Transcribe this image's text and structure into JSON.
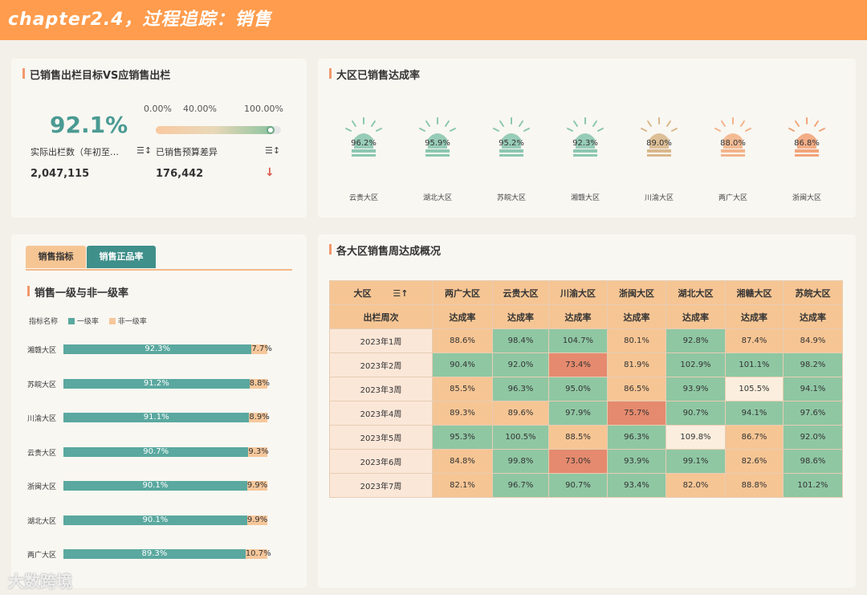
{
  "header": {
    "title": "chapter2.4，过程追踪：销售"
  },
  "kpi_panel": {
    "title": "已销售出栏目标VS应销售出栏",
    "rate": "92.1%",
    "rate_label": "实际出栏数（年初至…",
    "rate_value": "2,047,115",
    "slider_ticks": [
      "0.00%",
      "40.00%",
      "100.00%"
    ],
    "slider_level": 0.92,
    "diff_label": "已销售预算差异",
    "diff_value": "176,442",
    "sort_glyph": "☰↕",
    "down_arrow": "↓",
    "colors": {
      "rate": "#4a9a92",
      "arrow": "#d9574a"
    }
  },
  "alarm_panel": {
    "title": "大区已销售达成率",
    "regions": [
      {
        "name": "云贵大区",
        "pct": "96.2%",
        "color": "#8cc7b0"
      },
      {
        "name": "湖北大区",
        "pct": "95.9%",
        "color": "#8cc7b0"
      },
      {
        "name": "苏皖大区",
        "pct": "95.2%",
        "color": "#8cc7b0"
      },
      {
        "name": "湘赣大区",
        "pct": "92.3%",
        "color": "#8cc7b0"
      },
      {
        "name": "川渝大区",
        "pct": "89.0%",
        "color": "#d9b88c"
      },
      {
        "name": "两广大区",
        "pct": "88.0%",
        "color": "#f2b48a"
      },
      {
        "name": "浙闽大区",
        "pct": "86.8%",
        "color": "#f2a47a"
      }
    ]
  },
  "bar_panel": {
    "tabs": [
      "销售指标",
      "销售正品率"
    ],
    "active_tab": 1,
    "title": "销售一级与非一级率",
    "legend_title": "指标名称",
    "legend": [
      {
        "name": "一级率",
        "color": "#5aa89f"
      },
      {
        "name": "非一级率",
        "color": "#f6c79b"
      }
    ],
    "rows": [
      {
        "region": "湘赣大区",
        "first": "92.3%",
        "other": "7.7%",
        "first_val": 92.3
      },
      {
        "region": "苏皖大区",
        "first": "91.2%",
        "other": "8.8%",
        "first_val": 91.2
      },
      {
        "region": "川渝大区",
        "first": "91.1%",
        "other": "8.9%",
        "first_val": 91.1
      },
      {
        "region": "云贵大区",
        "first": "90.7%",
        "other": "9.3%",
        "first_val": 90.7
      },
      {
        "region": "浙闽大区",
        "first": "90.1%",
        "other": "9.9%",
        "first_val": 90.1
      },
      {
        "region": "湖北大区",
        "first": "90.1%",
        "other": "9.9%",
        "first_val": 90.1
      },
      {
        "region": "两广大区",
        "first": "89.3%",
        "other": "10.7%",
        "first_val": 89.3
      }
    ]
  },
  "table_panel": {
    "title": "各大区销售周达成概况",
    "corner_top": "大区",
    "corner_bottom": "出栏周次",
    "sort_glyph": "☰↑",
    "subheader": "达成率",
    "regions": [
      "两广大区",
      "云贵大区",
      "川渝大区",
      "浙闽大区",
      "湖北大区",
      "湘赣大区",
      "苏皖大区"
    ],
    "rows": [
      {
        "week": "2023年1周",
        "cells": [
          [
            "88.6%",
            "mid"
          ],
          [
            "98.4%",
            "hi"
          ],
          [
            "104.7%",
            "hi"
          ],
          [
            "80.1%",
            "mid"
          ],
          [
            "92.8%",
            "hi"
          ],
          [
            "87.4%",
            "mid"
          ],
          [
            "84.9%",
            "mid"
          ]
        ]
      },
      {
        "week": "2023年2周",
        "cells": [
          [
            "90.4%",
            "hi"
          ],
          [
            "92.0%",
            "hi"
          ],
          [
            "73.4%",
            "low"
          ],
          [
            "81.9%",
            "mid"
          ],
          [
            "102.9%",
            "hi"
          ],
          [
            "101.1%",
            "hi"
          ],
          [
            "98.2%",
            "hi"
          ]
        ]
      },
      {
        "week": "2023年3周",
        "cells": [
          [
            "85.5%",
            "mid"
          ],
          [
            "96.3%",
            "hi"
          ],
          [
            "95.0%",
            "hi"
          ],
          [
            "86.5%",
            "mid"
          ],
          [
            "93.9%",
            "hi"
          ],
          [
            "105.5%",
            "pale"
          ],
          [
            "94.1%",
            "hi"
          ]
        ]
      },
      {
        "week": "2023年4周",
        "cells": [
          [
            "89.3%",
            "mid"
          ],
          [
            "89.6%",
            "mid"
          ],
          [
            "97.9%",
            "hi"
          ],
          [
            "75.7%",
            "low"
          ],
          [
            "90.7%",
            "hi"
          ],
          [
            "94.1%",
            "hi"
          ],
          [
            "97.6%",
            "hi"
          ]
        ]
      },
      {
        "week": "2023年5周",
        "cells": [
          [
            "95.3%",
            "hi"
          ],
          [
            "100.5%",
            "hi"
          ],
          [
            "88.5%",
            "mid"
          ],
          [
            "96.3%",
            "hi"
          ],
          [
            "109.8%",
            "pale"
          ],
          [
            "86.7%",
            "mid"
          ],
          [
            "92.0%",
            "hi"
          ]
        ]
      },
      {
        "week": "2023年6周",
        "cells": [
          [
            "84.8%",
            "mid"
          ],
          [
            "99.8%",
            "hi"
          ],
          [
            "73.0%",
            "low"
          ],
          [
            "93.9%",
            "hi"
          ],
          [
            "99.1%",
            "hi"
          ],
          [
            "82.6%",
            "mid"
          ],
          [
            "98.6%",
            "hi"
          ]
        ]
      },
      {
        "week": "2023年7周",
        "cells": [
          [
            "82.1%",
            "mid"
          ],
          [
            "96.7%",
            "hi"
          ],
          [
            "90.7%",
            "hi"
          ],
          [
            "93.4%",
            "hi"
          ],
          [
            "82.0%",
            "mid"
          ],
          [
            "88.8%",
            "mid"
          ],
          [
            "101.2%",
            "hi"
          ]
        ]
      }
    ]
  },
  "watermark": "大数跨境"
}
